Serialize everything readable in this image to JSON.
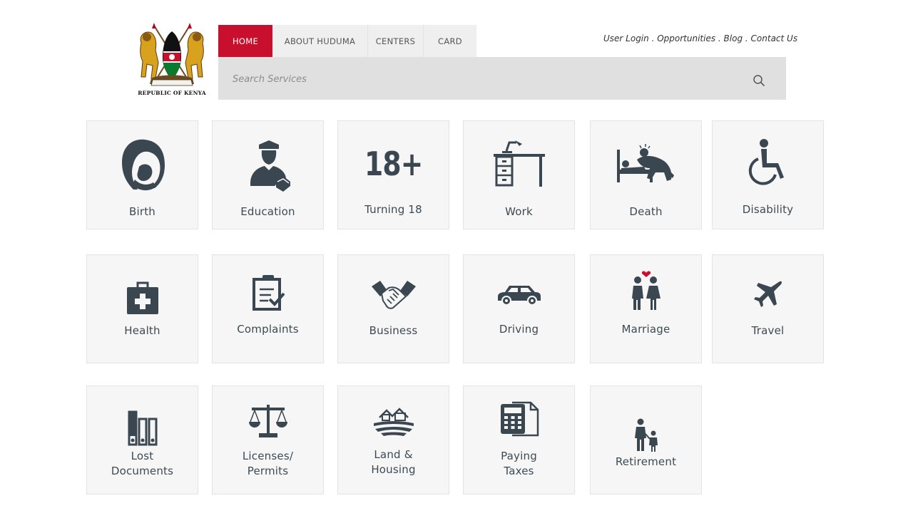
{
  "emblem": {
    "caption": "REPUBLIC OF KENYA"
  },
  "nav": {
    "items": [
      {
        "label": "HOME",
        "active": true
      },
      {
        "label": "ABOUT HUDUMA",
        "active": false
      },
      {
        "label": "CENTERS",
        "active": false
      },
      {
        "label": "CARD",
        "active": false
      }
    ]
  },
  "top_links": {
    "user_login": "User Login",
    "opportunities": "Opportunities",
    "blog": "Blog",
    "contact_us": "Contact Us",
    "separator": " . "
  },
  "search": {
    "placeholder": "Search Services",
    "value": ""
  },
  "services": [
    {
      "label": "Birth",
      "icon": "mother-baby-icon"
    },
    {
      "label": "Education",
      "icon": "graduate-icon"
    },
    {
      "label": "Turning 18",
      "icon": "eighteen-plus-icon",
      "icon_text": "18+"
    },
    {
      "label": "Work",
      "icon": "desk-icon"
    },
    {
      "label": "Death",
      "icon": "bedside-mourning-icon"
    },
    {
      "label": "Disability",
      "icon": "wheelchair-icon"
    },
    {
      "label": "Health",
      "icon": "medical-kit-icon"
    },
    {
      "label": "Complaints",
      "icon": "clipboard-check-icon"
    },
    {
      "label": "Business",
      "icon": "handshake-icon"
    },
    {
      "label": "Driving",
      "icon": "car-icon"
    },
    {
      "label": "Marriage",
      "icon": "couple-icon"
    },
    {
      "label": "Travel",
      "icon": "airplane-icon"
    },
    {
      "label_line1": "Lost",
      "label_line2": "Documents",
      "icon": "binders-icon"
    },
    {
      "label_line1": "Licenses/",
      "label_line2": "Permits",
      "icon": "scales-icon"
    },
    {
      "label_line1": "Land &",
      "label_line2": "Housing",
      "icon": "houses-icon"
    },
    {
      "label_line1": "Paying",
      "label_line2": "Taxes",
      "icon": "calculator-icon"
    },
    {
      "label": "Retirement",
      "icon": "parent-child-icon"
    }
  ],
  "colors": {
    "accent": "#c8102e",
    "nav_bg": "#efefef",
    "search_bg": "#e0e0e0",
    "tile_bg": "#f6f6f7",
    "icon": "#3b4750"
  }
}
